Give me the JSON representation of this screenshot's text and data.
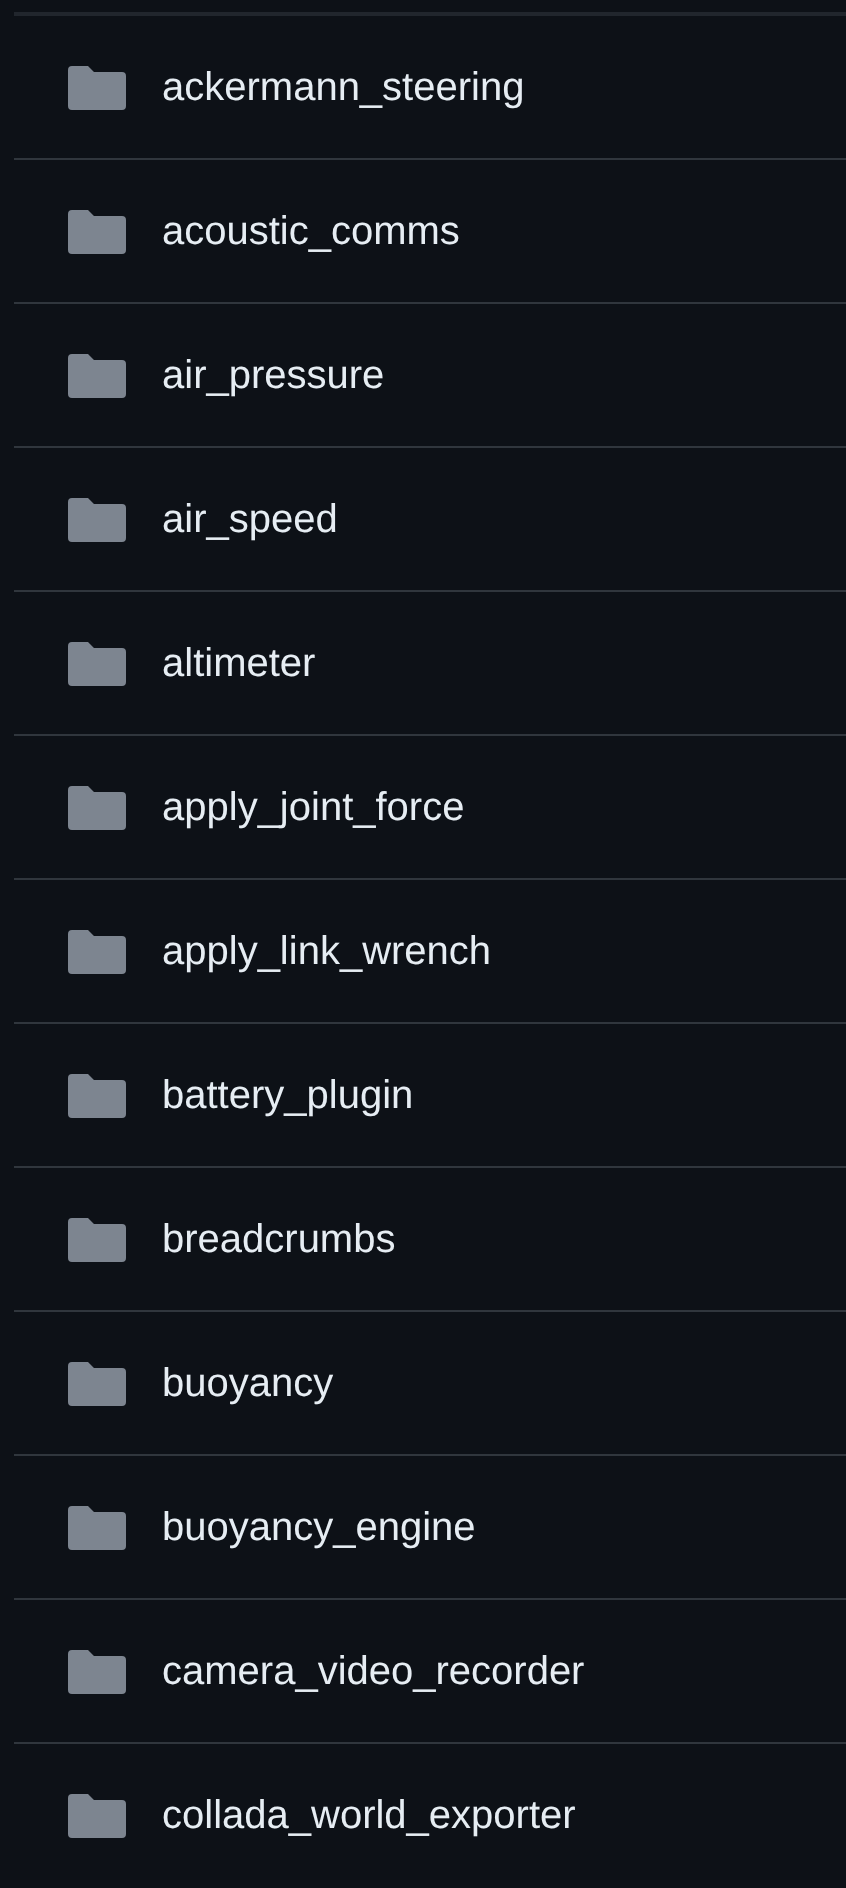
{
  "folders": [
    {
      "name": "ackermann_steering"
    },
    {
      "name": "acoustic_comms"
    },
    {
      "name": "air_pressure"
    },
    {
      "name": "air_speed"
    },
    {
      "name": "altimeter"
    },
    {
      "name": "apply_joint_force"
    },
    {
      "name": "apply_link_wrench"
    },
    {
      "name": "battery_plugin"
    },
    {
      "name": "breadcrumbs"
    },
    {
      "name": "buoyancy"
    },
    {
      "name": "buoyancy_engine"
    },
    {
      "name": "camera_video_recorder"
    },
    {
      "name": "collada_world_exporter"
    }
  ]
}
